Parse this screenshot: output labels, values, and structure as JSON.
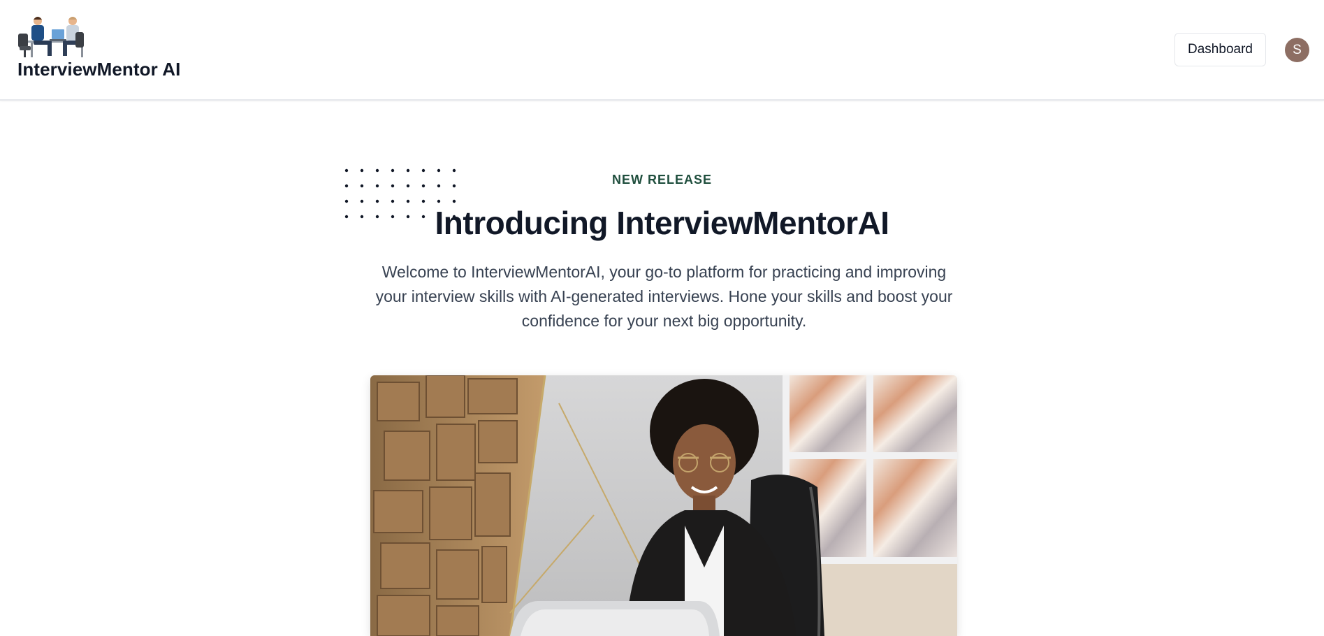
{
  "header": {
    "brand": "InterviewMentor AI",
    "logo_icon": "interview-illustration-logo",
    "dashboard_label": "Dashboard",
    "avatar_initial": "S"
  },
  "hero": {
    "eyebrow": "NEW RELEASE",
    "title": "Introducing InterviewMentorAI",
    "description": "Welcome to InterviewMentorAI, your go-to platform for practicing and improving your interview skills with AI-generated interviews. Hone your skills and boost your confidence for your next big opportunity.",
    "image_icon": "woman-at-laptop-photo"
  },
  "colors": {
    "accent": "#1f4e3d",
    "avatar": "#8d6e63",
    "text": "#111827",
    "muted": "#374151"
  }
}
